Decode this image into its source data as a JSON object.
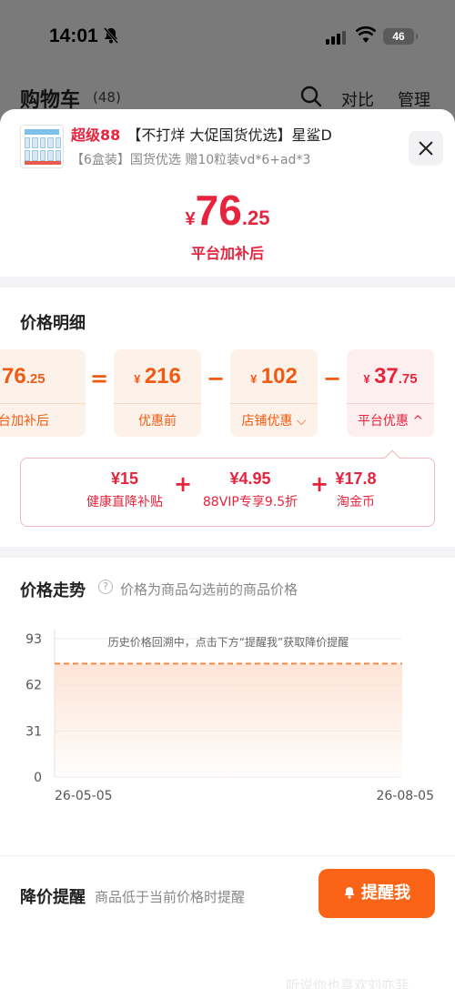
{
  "status": {
    "time": "14:01",
    "battery": "46"
  },
  "cart": {
    "title": "购物车",
    "count": "(48)",
    "compare": "对比",
    "manage": "管理"
  },
  "product": {
    "badge": "超级88",
    "title": "【不打烊 大促国货优选】星鲨D",
    "subtitle": "【6盒装】国货优选 赠10粒装vd*6+ad*3"
  },
  "final_price": {
    "currency": "¥",
    "integer": "76",
    "decimal": ".25",
    "caption": "平台加补后"
  },
  "breakdown": {
    "title": "价格明细",
    "items": [
      {
        "currency": "",
        "integer": "76",
        "decimal": ".25",
        "label": "台加补后"
      },
      {
        "currency": "¥",
        "integer": "216",
        "decimal": "",
        "label": "优惠前"
      },
      {
        "currency": "¥",
        "integer": "102",
        "decimal": "",
        "label": "店铺优惠"
      },
      {
        "currency": "¥",
        "integer": "37",
        "decimal": ".75",
        "label": "平台优惠"
      }
    ],
    "ops": [
      "=",
      "−",
      "−"
    ],
    "platform_detail": [
      {
        "value": "¥15",
        "label": "健康直降补贴"
      },
      {
        "value": "¥4.95",
        "label": "88VIP专享9.5折"
      },
      {
        "value": "¥17.8",
        "label": "淘金币"
      }
    ],
    "plus": "+"
  },
  "trend": {
    "title": "价格走势",
    "note": "价格为商品勾选前的商品价格",
    "hint": "历史价格回溯中，点击下方“提醒我”获取降价提醒"
  },
  "chart_data": {
    "type": "area",
    "x": [
      "26-05-05",
      "26-08-05"
    ],
    "series": [
      {
        "values": [
          76.25,
          76.25
        ]
      }
    ],
    "yticks": [
      0,
      31,
      62,
      93
    ],
    "xticks": [
      "26-05-05",
      "26-08-05"
    ],
    "ylim": [
      0,
      93
    ],
    "grid": true,
    "colors": {
      "line": "#f58a4a",
      "fill": "#fde3d4"
    }
  },
  "remind": {
    "title": "降价提醒",
    "note": "商品低于当前价格时提醒",
    "button": "提醒我"
  },
  "watermark": "听说你也喜欢刘亦菲"
}
